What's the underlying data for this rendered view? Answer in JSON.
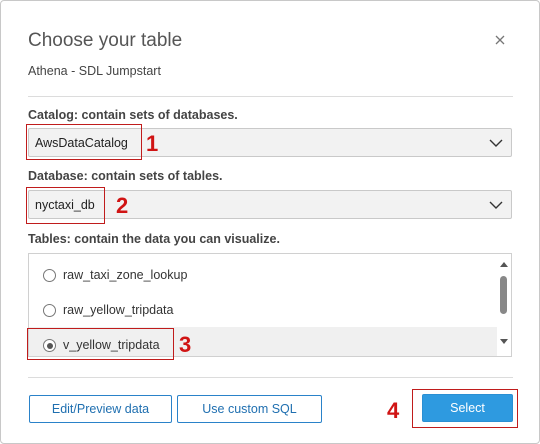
{
  "dialog": {
    "title": "Choose your table",
    "subtitle": "Athena - SDL Jumpstart",
    "close_icon": "close-icon"
  },
  "catalog": {
    "label": "Catalog: contain sets of databases.",
    "value": "AwsDataCatalog",
    "annotation": "1"
  },
  "database": {
    "label": "Database: contain sets of tables.",
    "value": "nyctaxi_db",
    "annotation": "2"
  },
  "tables": {
    "label": "Tables: contain the data you can visualize.",
    "items": [
      {
        "name": "raw_taxi_zone_lookup",
        "selected": false
      },
      {
        "name": "raw_yellow_tripdata",
        "selected": false
      },
      {
        "name": "v_yellow_tripdata",
        "selected": true
      }
    ],
    "annotation": "3"
  },
  "buttons": {
    "edit_preview": "Edit/Preview data",
    "custom_sql": "Use custom SQL",
    "select": "Select",
    "select_annotation": "4"
  },
  "colors": {
    "annotation_red": "#d01414",
    "primary_blue": "#2e9ae0",
    "outline_blue": "#2a82c9"
  }
}
